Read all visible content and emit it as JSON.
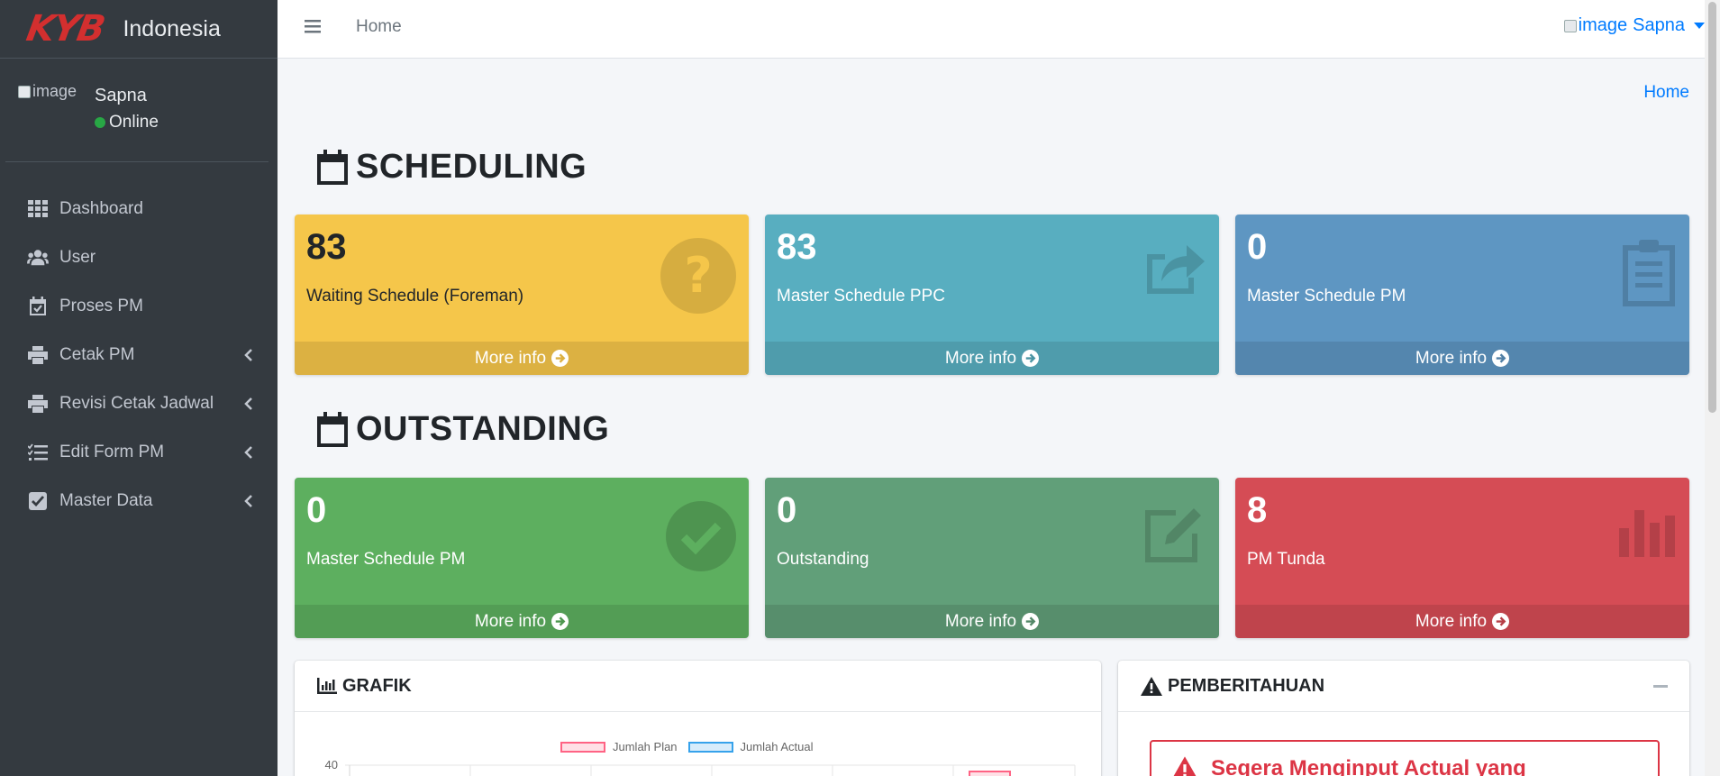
{
  "brand": {
    "logo": "KYB",
    "name": "Indonesia"
  },
  "user_panel": {
    "image_alt": "image",
    "name": "Sapna",
    "status": "Online"
  },
  "nav": [
    {
      "label": "Dashboard",
      "icon": "grid-icon",
      "has_submenu": false
    },
    {
      "label": "User",
      "icon": "users-icon",
      "has_submenu": false
    },
    {
      "label": "Proses PM",
      "icon": "calendar-check-icon",
      "has_submenu": false
    },
    {
      "label": "Cetak PM",
      "icon": "printer-icon",
      "has_submenu": true
    },
    {
      "label": "Revisi Cetak Jadwal",
      "icon": "printer-icon",
      "has_submenu": true
    },
    {
      "label": "Edit Form PM",
      "icon": "list-check-icon",
      "has_submenu": true
    },
    {
      "label": "Master Data",
      "icon": "checkbox-icon",
      "has_submenu": true
    }
  ],
  "header": {
    "home_link": "Home",
    "user_image_alt": "image",
    "user_name": "Sapna"
  },
  "breadcrumb": "Home",
  "sections": {
    "scheduling": "SCHEDULING",
    "outstanding": "OUTSTANDING"
  },
  "boxes": [
    {
      "value": "83",
      "label": "Waiting Schedule (Foreman)",
      "footer": "More info",
      "icon": "question-circle-icon",
      "color": "#f5c64a"
    },
    {
      "value": "83",
      "label": "Master Schedule PPC",
      "footer": "More info",
      "icon": "share-icon",
      "color": "#58aec0"
    },
    {
      "value": "0",
      "label": "Master Schedule PM",
      "footer": "More info",
      "icon": "clipboard-icon",
      "color": "#5e96c2"
    },
    {
      "value": "0",
      "label": "Master Schedule PM",
      "footer": "More info",
      "icon": "check-circle-icon",
      "color": "#5daf5f"
    },
    {
      "value": "0",
      "label": "Outstanding",
      "footer": "More info",
      "icon": "edit-icon",
      "color": "#619f79"
    },
    {
      "value": "8",
      "label": "PM Tunda",
      "footer": "More info",
      "icon": "bar-chart-icon",
      "color": "#d54c55"
    }
  ],
  "grafik": {
    "title": "GRAFIK",
    "chart_data": {
      "type": "bar",
      "series": [
        {
          "name": "Jumlah Plan",
          "color": "#ff6384"
        },
        {
          "name": "Jumlah Actual",
          "color": "#36a2eb"
        }
      ],
      "y_ticks": [
        "40"
      ]
    }
  },
  "pemberitahuan": {
    "title": "PEMBERITAHUAN",
    "alert_text": "Segera Menginput Actual yang"
  }
}
